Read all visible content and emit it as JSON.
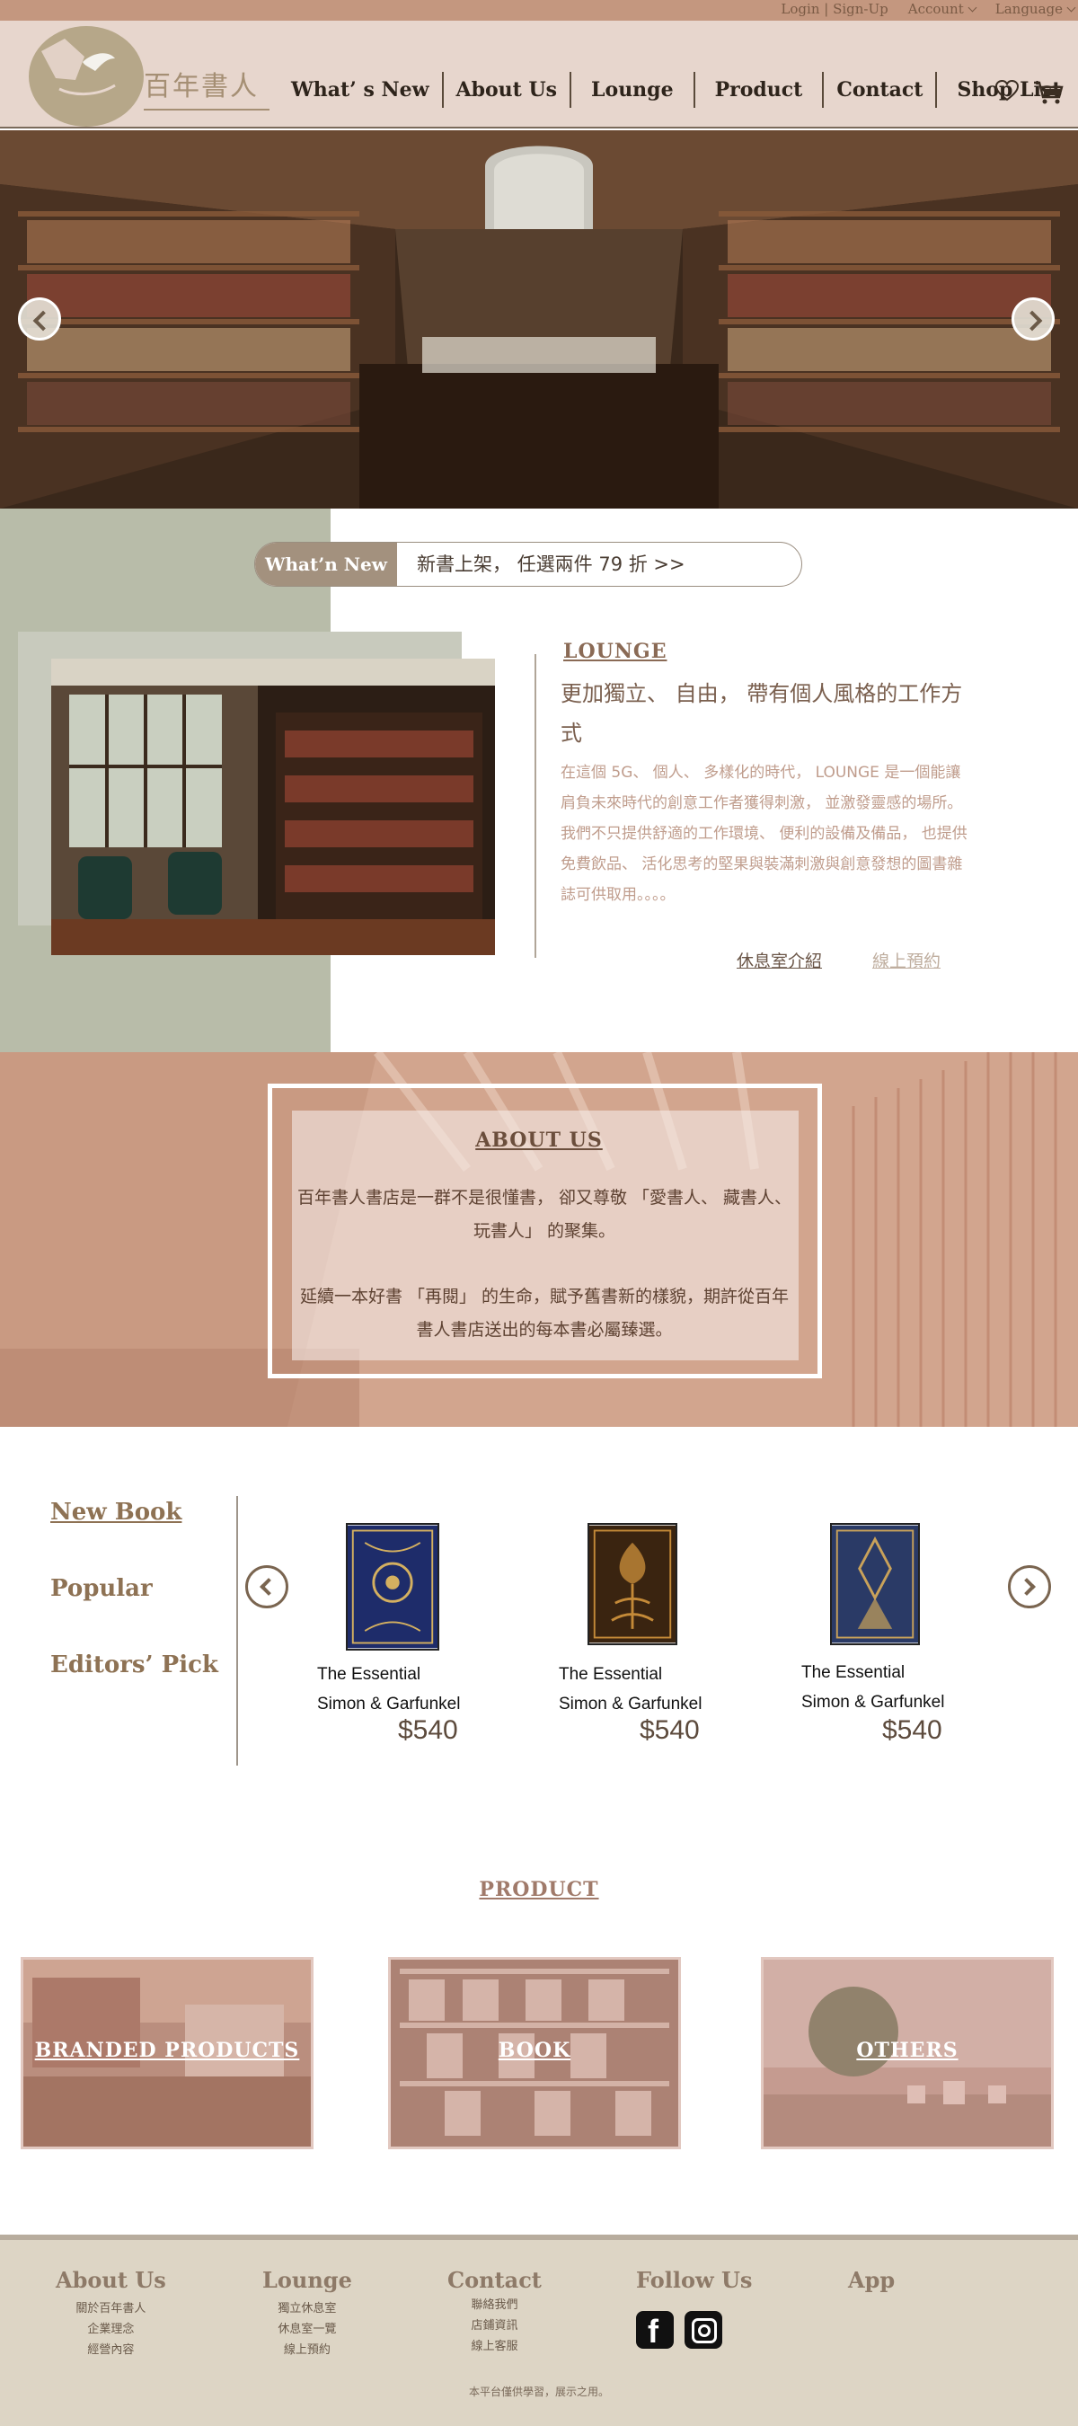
{
  "util": {
    "login": "Login",
    "signup": "Sign-Up",
    "account": "Account",
    "language": "Language"
  },
  "brand": {
    "name": "百年書人"
  },
  "nav": [
    "What’ s New",
    "About Us",
    "Lounge",
    "Product",
    "Contact",
    "Shop List"
  ],
  "icons": {
    "wishlist": "heart-icon",
    "cart": "cart-icon"
  },
  "whats_new": {
    "tag": "What’n New",
    "text": "新書上架， 任選兩件 79 折 >>"
  },
  "lounge": {
    "heading": "LOUNGE",
    "title": "更加獨立、 自由， 帶有個人風格的工作方式",
    "body": "在這個 5G、 個人、 多樣化的時代， LOUNGE 是一個能讓肩負未來時代的創意工作者獲得刺激， 並激發靈感的場所。",
    "body2": "我們不只提供舒適的工作環境、 便利的設備及備品， 也提供免費飲品、 活化思考的堅果與裝滿刺激與創意發想的圖書雜誌可供取用。。。。",
    "link_intro": "休息室介紹",
    "link_book": "線上預約"
  },
  "about": {
    "title": "ABOUT US",
    "p1": "百年書人書店是一群不是很懂書， 卻又尊敬 「愛書人、 藏書人、 玩書人」 的聚集。",
    "p2": "延續一本好書 「再閱」 的生命，賦予舊書新的樣貌，期許從百年書人書店送出的每本書必屬臻選。"
  },
  "books": {
    "categories": [
      "New Book",
      "Popular",
      "Editors’ Pick"
    ],
    "items": [
      {
        "line1": "The Essential",
        "line2": "Simon & Garfunkel",
        "price": "$540"
      },
      {
        "line1": "The Essential",
        "line2": "Simon & Garfunkel",
        "price": "$540"
      },
      {
        "line1": "The Essential",
        "line2": "Simon & Garfunkel",
        "price": "$540"
      }
    ]
  },
  "product": {
    "title": "PRODUCT",
    "cards": [
      "BRANDED PRODUCTS",
      "BOOK",
      "OTHERS"
    ]
  },
  "footer": {
    "cols": [
      {
        "head": "About Us",
        "links": [
          "關於百年書人",
          "企業理念",
          "經營內容"
        ]
      },
      {
        "head": "Lounge",
        "links": [
          "獨立休息室",
          "休息室一覽",
          "線上預約"
        ]
      },
      {
        "head": "Contact",
        "links": [
          "聯絡我們",
          "店鋪資訊",
          "線上客服"
        ]
      },
      {
        "head": "Follow Us",
        "links": []
      },
      {
        "head": "App",
        "links": []
      }
    ],
    "note": "本平台僅供學習，展示之用。"
  },
  "colors": {
    "accent": "#c4977f",
    "header_bg": "#e7d6cd",
    "sage": "#b8bca9",
    "footer_bg": "#ddd5c5"
  }
}
